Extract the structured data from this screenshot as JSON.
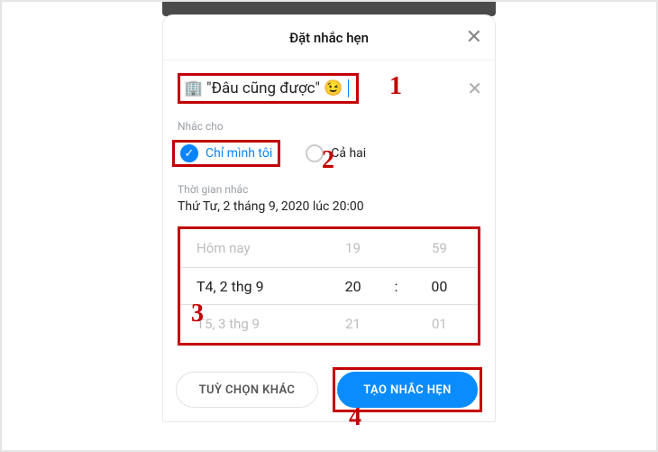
{
  "dialog": {
    "title": "Đặt nhắc hẹn",
    "close": "✕"
  },
  "input": {
    "emoji_left": "🏢",
    "value": "\"Đâu cũng được\"",
    "emoji_right": "😉",
    "clear": "✕"
  },
  "remindFor": {
    "label": "Nhắc cho",
    "options": {
      "me": "Chỉ mình tôi",
      "both": "Cả hai"
    }
  },
  "remindTime": {
    "label": "Thời gian nhắc",
    "summary": "Thứ Tư, 2 tháng 9, 2020 lúc 20:00"
  },
  "picker": {
    "date": {
      "prev": "Hôm nay",
      "mid": "T4, 2 thg 9",
      "next": "T5, 3 thg 9"
    },
    "hour": {
      "prev": "19",
      "mid": "20",
      "next": "21"
    },
    "minute": {
      "prev": "59",
      "mid": "00",
      "next": "01"
    },
    "sep": ":"
  },
  "footer": {
    "secondary": "TUỲ CHỌN KHÁC",
    "primary": "TẠO NHẮC HẸN"
  },
  "annotations": {
    "a1": "1",
    "a2": "2",
    "a3": "3",
    "a4": "4"
  }
}
